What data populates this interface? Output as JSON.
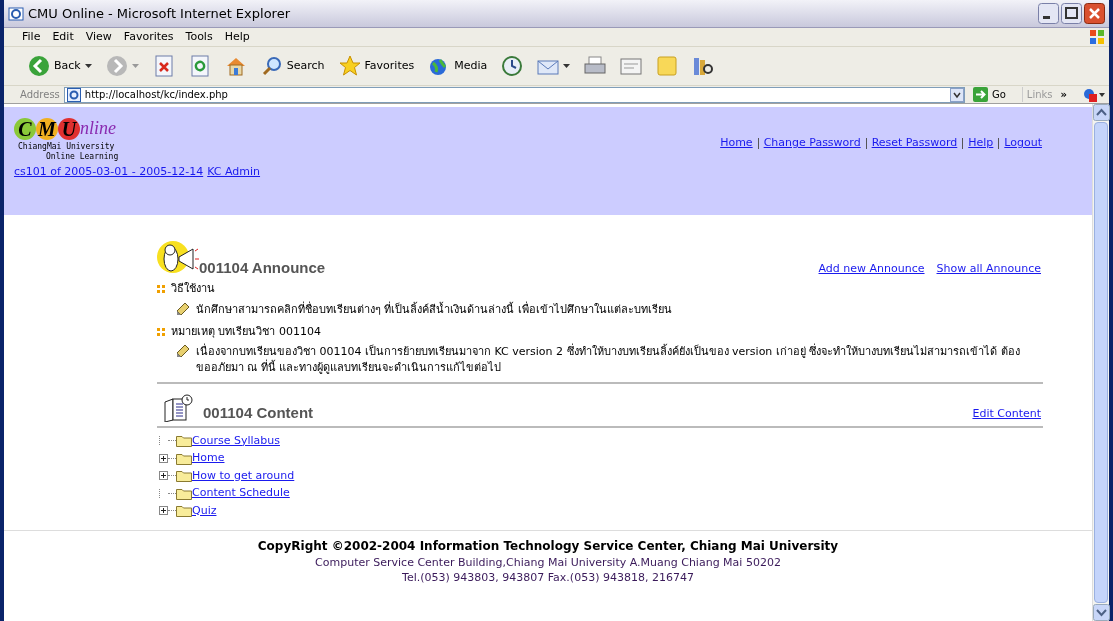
{
  "window": {
    "title": "CMU Online - Microsoft Internet Explorer"
  },
  "menu": [
    "File",
    "Edit",
    "View",
    "Favorites",
    "Tools",
    "Help"
  ],
  "toolbar": [
    {
      "kind": "back",
      "label": "Back"
    },
    {
      "kind": "forward"
    },
    {
      "kind": "stop"
    },
    {
      "kind": "refresh"
    },
    {
      "kind": "home"
    },
    {
      "kind": "search",
      "label": "Search"
    },
    {
      "kind": "favorites",
      "label": "Favorites"
    },
    {
      "kind": "media",
      "label": "Media"
    },
    {
      "kind": "history"
    },
    {
      "kind": "mail"
    },
    {
      "kind": "print"
    },
    {
      "kind": "edit"
    },
    {
      "kind": "note"
    },
    {
      "kind": "research"
    }
  ],
  "address": {
    "label": "Address",
    "value": "http://localhost/kc/index.php",
    "go": "Go",
    "links": "Links",
    "more": "»"
  },
  "header": {
    "logo": {
      "letters": [
        "C",
        "M",
        "U"
      ],
      "word": "nline",
      "subtitle": [
        "ChiangMai University",
        "Online Learning"
      ]
    },
    "nav": [
      "Home",
      "Change Password",
      "Reset Password",
      "Help",
      "Logout"
    ],
    "course_link": "cs101 of 2005-03-01 - 2005-12-14",
    "user_link": "KC Admin"
  },
  "announce": {
    "title": "001104 Announce",
    "actions": [
      "Add new Announce",
      "Show all Announce"
    ],
    "items": [
      {
        "heading": "วิธีใช้งาน",
        "body": "นักศึกษาสามารถคลิกที่ชื่อบทเรียนต่างๆ ที่เป็นลิ้งค์สีน้ำเงินด้านล่างนี้ เพื่อเข้าไปศึกษาในแต่ละบทเรียน"
      },
      {
        "heading": "หมายเหตุ บทเรียนวิชา 001104",
        "body": "เนื่องจากบทเรียนของวิชา 001104 เป็นการย้ายบทเรียนมาจาก KC version 2 ซึ่งทำให้บางบทเรียนลิ้งค์ยังเป็นของ version เก่าอยู่ ซึ่งจะทำให้บางบทเรียนไม่สามารถเข้าได้ ต้องขออภัยมา ณ ที่นี้ และทางผู้ดูแลบทเรียนจะดำเนินการแก้ไขต่อไป"
      }
    ]
  },
  "content": {
    "title": "001104 Content",
    "action": "Edit Content",
    "tree": [
      {
        "label": "Course Syllabus",
        "expandable": false
      },
      {
        "label": "Home",
        "expandable": true
      },
      {
        "label": "How to get around",
        "expandable": true
      },
      {
        "label": "Content Schedule",
        "expandable": false
      },
      {
        "label": "Quiz",
        "expandable": true
      }
    ]
  },
  "footer": {
    "copyright": "CopyRight ©2002-2004 Information Technology Service Center, Chiang Mai University",
    "lines": [
      "Computer Service Center Building,Chiang Mai University A.Muang Chiang Mai 50202",
      "Tel.(053) 943803, 943807 Fax.(053) 943818, 216747"
    ]
  }
}
